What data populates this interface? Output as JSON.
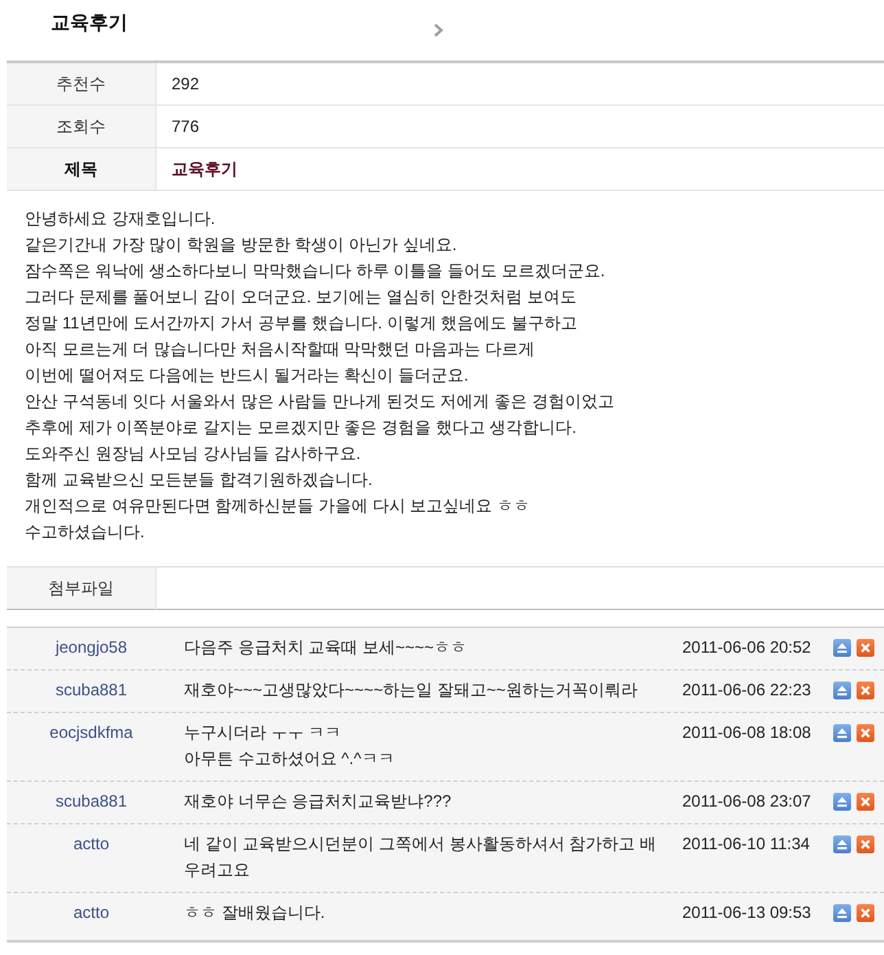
{
  "page_title": "교육후기",
  "info_rows": [
    {
      "kind": "stat",
      "label": "추천수",
      "value": "292"
    },
    {
      "kind": "stat",
      "label": "조회수",
      "value": "776"
    },
    {
      "kind": "title",
      "label": "제목",
      "value": "교육후기"
    }
  ],
  "body_lines": [
    "안녕하세요 강재호입니다.",
    "같은기간내 가장 많이 학원을 방문한 학생이 아닌가 싶네요.",
    "잠수쪽은 워낙에 생소하다보니 막막했습니다 하루 이틀을 들어도 모르겠더군요.",
    "그러다 문제를 풀어보니 감이 오더군요. 보기에는 열심히 안한것처럼 보여도",
    "정말 11년만에 도서간까지 가서 공부를 했습니다. 이렇게 했음에도 불구하고",
    "아직 모르는게 더 많습니다만 처음시작할때 막막했던 마음과는 다르게",
    "이번에 떨어져도 다음에는 반드시 될거라는 확신이 들더군요.",
    "안산 구석동네 잇다 서울와서 많은 사람들 만나게 된것도 저에게 좋은 경험이었고",
    "추후에 제가 이쪽분야로 갈지는 모르겠지만 좋은 경험을 했다고 생각합니다.",
    "도와주신 원장님 사모님 강사님들 감사하구요.",
    "함께 교육받으신 모든분들 합격기원하겠습니다.",
    "개인적으로 여유만된다면 함께하신분들 가을에 다시 보고싶네요 ㅎㅎ",
    "수고하셨습니다."
  ],
  "attachment": {
    "label": "첨부파일"
  },
  "comments": [
    {
      "author": "jeongjo58",
      "lines": [
        "다음주 응급처치 교육때 보세~~~~ㅎㅎ"
      ],
      "date": "2011-06-06 20:52"
    },
    {
      "author": "scuba881",
      "lines": [
        "재호야~~~고생많았다~~~~하는일 잘돼고~~원하는거꼭이뤄라"
      ],
      "date": "2011-06-06 22:23"
    },
    {
      "author": "eocjsdkfma",
      "lines": [
        "누구시더라 ㅜㅜ ㅋㅋ",
        "아무튼 수고하셨어요 ^.^ㅋㅋ"
      ],
      "date": "2011-06-08 18:08"
    },
    {
      "author": "scuba881",
      "lines": [
        "재호야 너무슨 응급처치교육받냐???"
      ],
      "date": "2011-06-08 23:07"
    },
    {
      "author": "actto",
      "lines": [
        "네 같이 교육받으시던분이 그쪽에서 봉사활동하셔서 참가하고 배우려고요"
      ],
      "date": "2011-06-10 11:34"
    },
    {
      "author": "actto",
      "lines": [
        "ㅎㅎ 잘배웠습니다."
      ],
      "date": "2011-06-13 09:53"
    }
  ]
}
